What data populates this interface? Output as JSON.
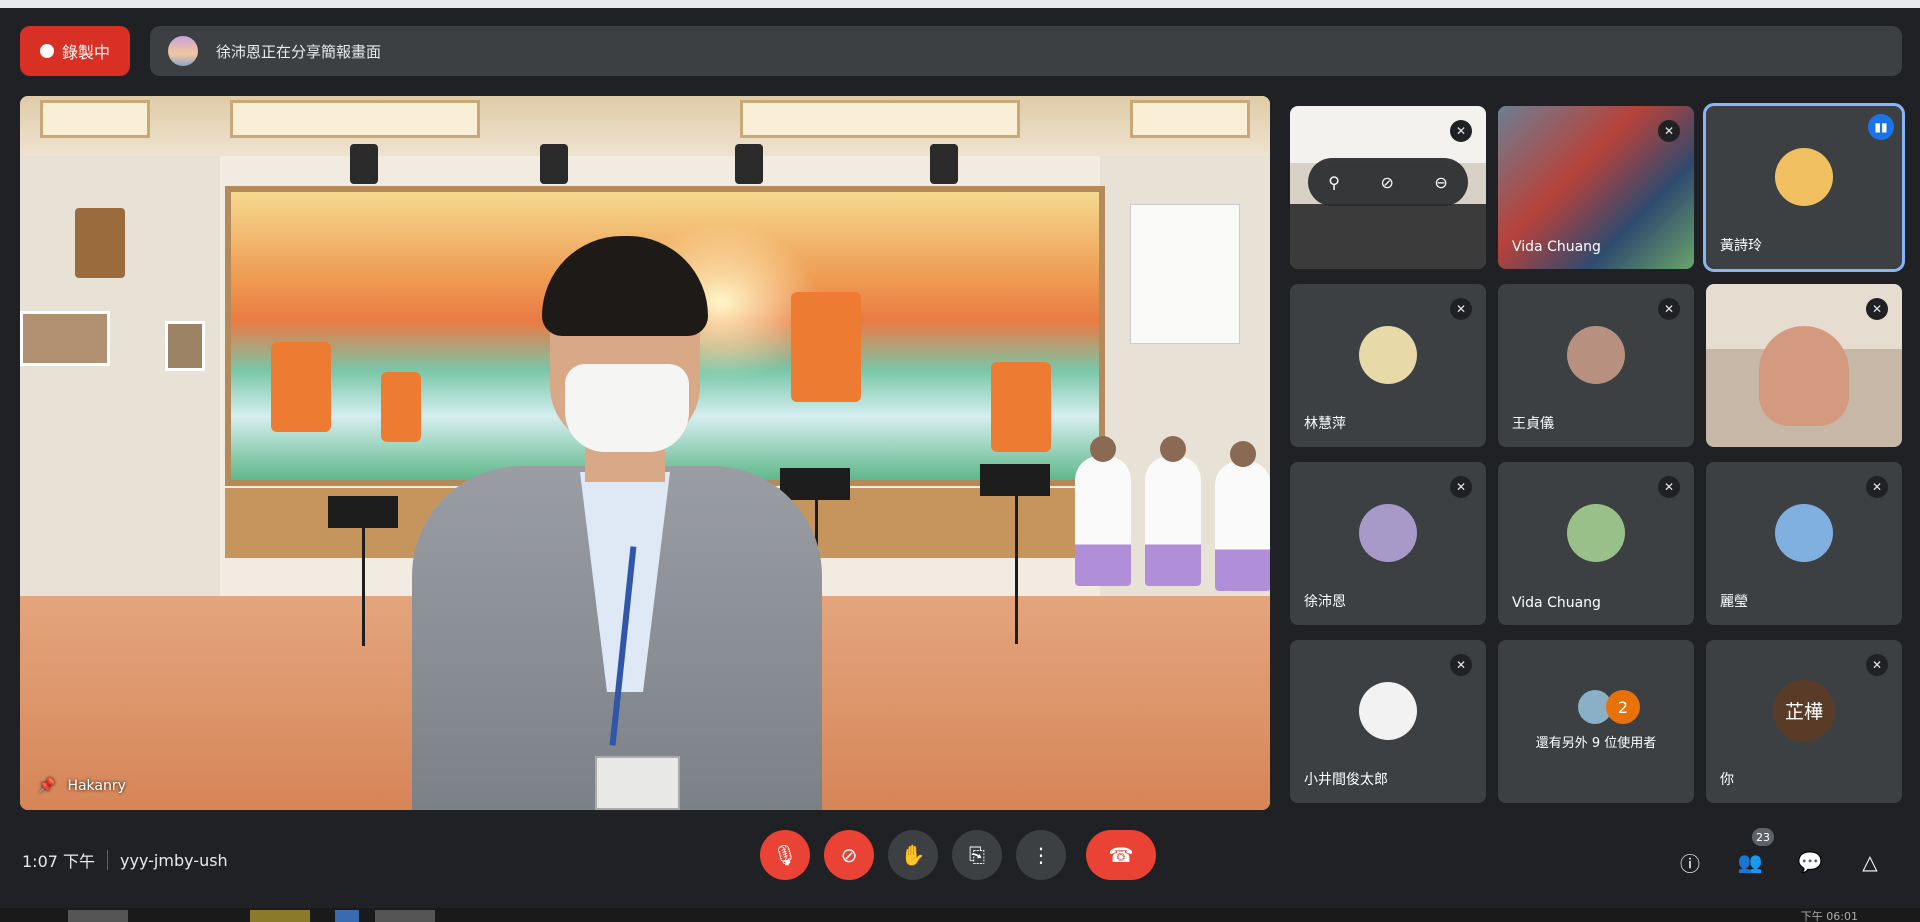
{
  "recording": {
    "label": "錄製中"
  },
  "share_banner": {
    "text": "徐沛恩正在分享簡報畫面"
  },
  "main_video": {
    "name": "Hakanry"
  },
  "participants": [
    {
      "name": "",
      "kind": "video",
      "muted": true,
      "hover_controls": [
        "pin-icon",
        "mute-icon",
        "remove-icon"
      ]
    },
    {
      "name": "Vida Chuang",
      "kind": "video",
      "muted": true
    },
    {
      "name": "黃詩玲",
      "kind": "avatar",
      "speaking": true,
      "avatar_color": "#f0c060"
    },
    {
      "name": "林慧萍",
      "kind": "avatar",
      "muted": true,
      "avatar_color": "#e8d9a8"
    },
    {
      "name": "王貞儀",
      "kind": "avatar",
      "muted": true,
      "avatar_color": "#b89080"
    },
    {
      "name": "",
      "kind": "video",
      "muted": true
    },
    {
      "name": "徐沛恩",
      "kind": "avatar",
      "muted": true,
      "avatar_color": "#a89ac8"
    },
    {
      "name": "Vida Chuang",
      "kind": "avatar",
      "muted": true,
      "avatar_color": "#9ac089"
    },
    {
      "name": "麗瑩",
      "kind": "avatar",
      "muted": true,
      "avatar_color": "#7fb0e0"
    },
    {
      "name": "小井間俊太郎",
      "kind": "avatar",
      "muted": true,
      "avatar_color": "#f2f2f2"
    },
    {
      "name": "還有另外 9 位使用者",
      "kind": "more",
      "count": "2"
    },
    {
      "name": "你",
      "kind": "initials",
      "initials": "芷樺",
      "muted": true
    }
  ],
  "meeting": {
    "time": "1:07 下午",
    "code": "yyy-jmby-ush"
  },
  "controls": {
    "mic": "mic-off-icon",
    "camera": "camera-off-icon",
    "raise_hand": "hand-icon",
    "present": "present-icon",
    "more": "more-icon",
    "end": "end-call-icon"
  },
  "right_controls": {
    "participant_count": "23"
  },
  "taskbar": {
    "time": "下午 06:01"
  },
  "colors": {
    "background": "#202124",
    "tile": "#3c4043",
    "danger": "#ea4335",
    "accent": "#8ab4f8"
  }
}
